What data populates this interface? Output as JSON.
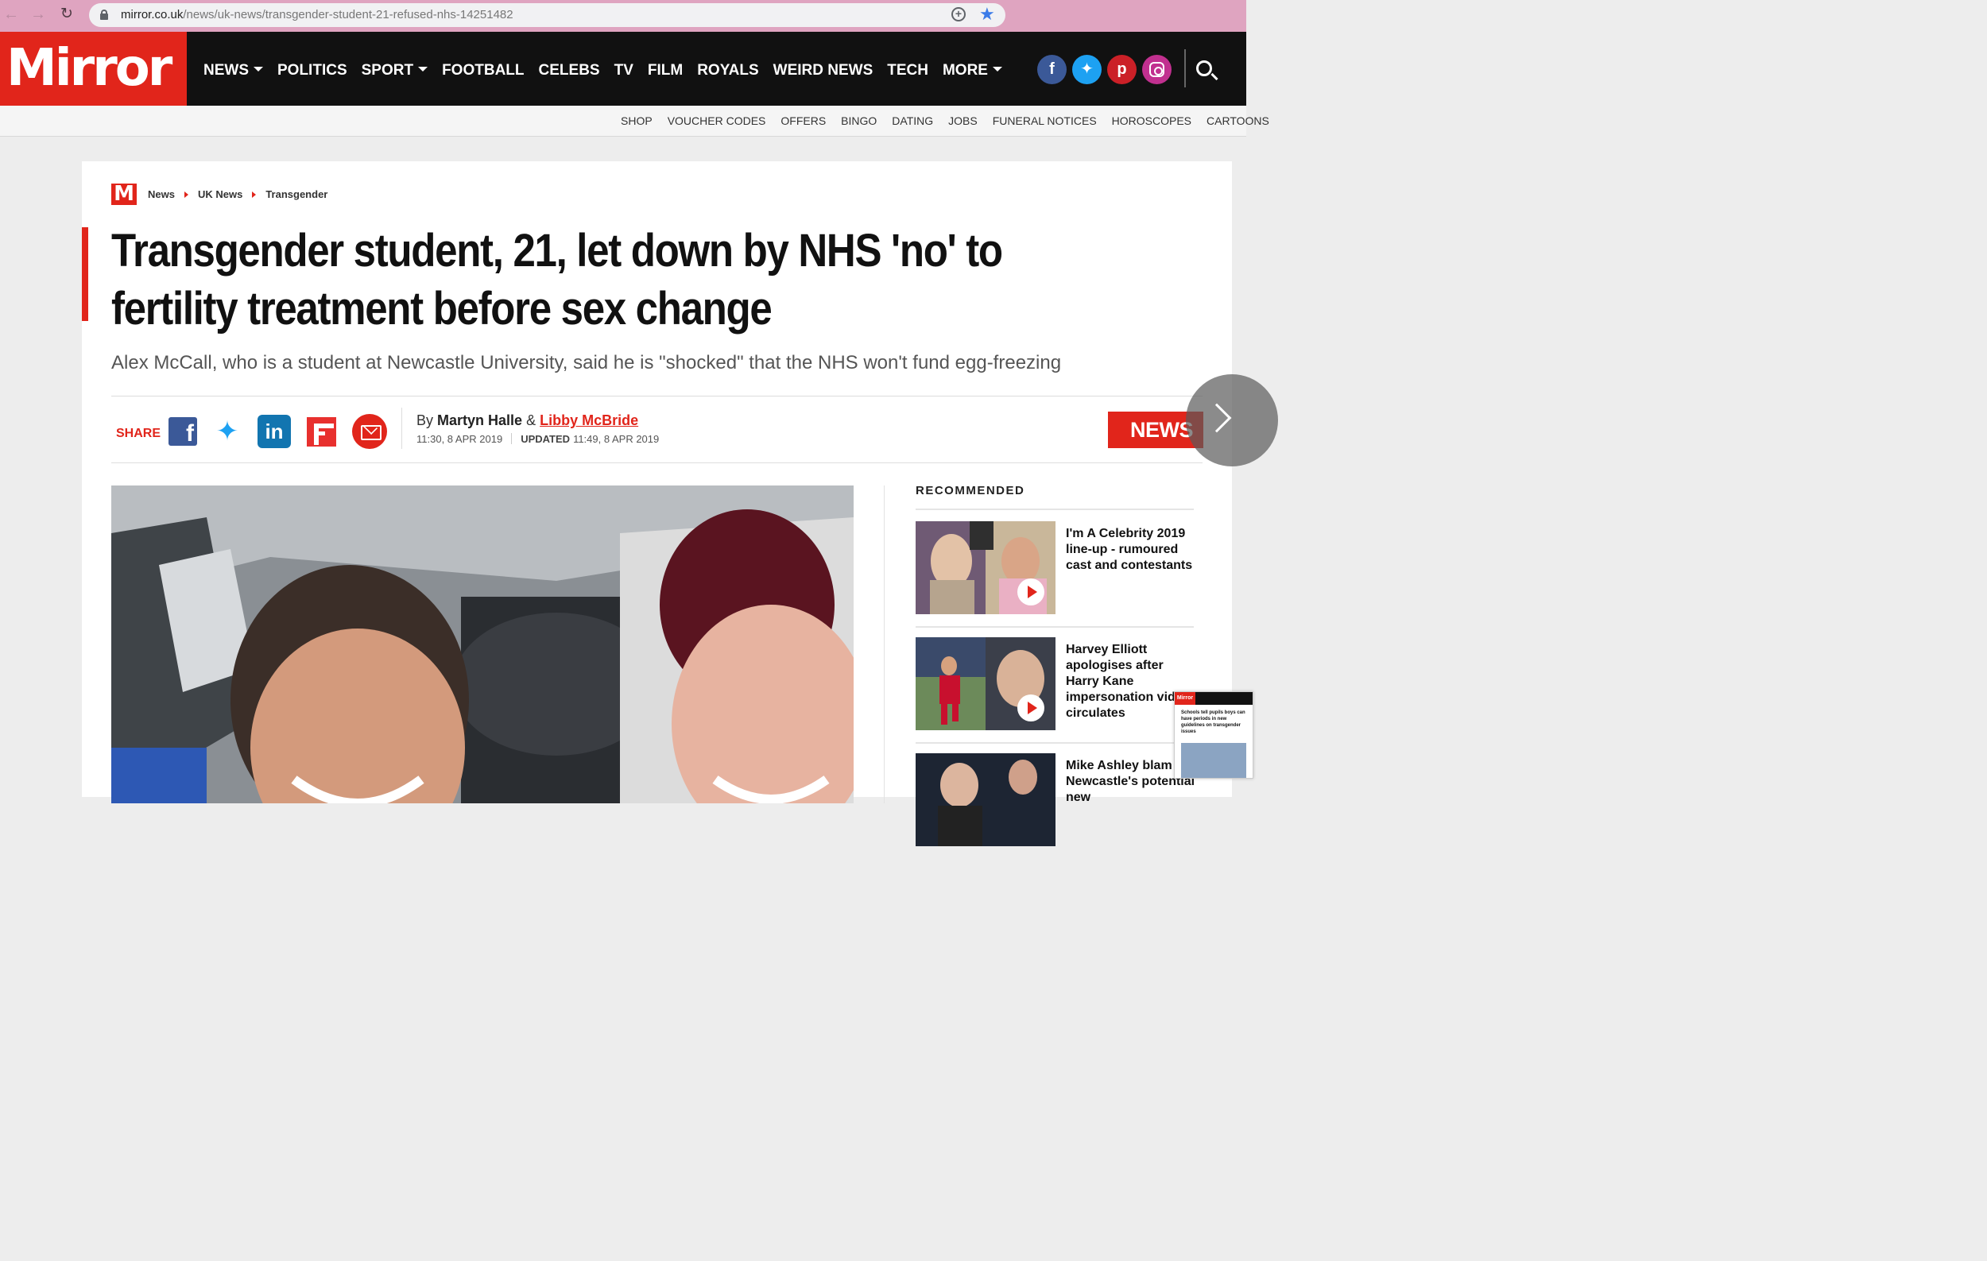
{
  "browser": {
    "url_domain": "mirror.co.uk",
    "url_path": "/news/uk-news/transgender-student-21-refused-nhs-14251482"
  },
  "header": {
    "logo": "Mirror",
    "nav": [
      "NEWS",
      "POLITICS",
      "SPORT",
      "FOOTBALL",
      "CELEBS",
      "TV",
      "FILM",
      "ROYALS",
      "WEIRD NEWS",
      "TECH",
      "MORE"
    ],
    "nav_dropdown": [
      "NEWS",
      "SPORT",
      "MORE"
    ],
    "social": [
      "facebook-icon",
      "twitter-icon",
      "pinterest-icon",
      "instagram-icon"
    ],
    "brand_color": "#e1251b"
  },
  "subnav": [
    "SHOP",
    "VOUCHER CODES",
    "OFFERS",
    "BINGO",
    "DATING",
    "JOBS",
    "FUNERAL NOTICES",
    "HOROSCOPES",
    "CARTOONS"
  ],
  "breadcrumb": {
    "logo": "M",
    "items": [
      "News",
      "UK News",
      "Transgender"
    ]
  },
  "article": {
    "headline": "Transgender student, 21, let down by NHS 'no' to fertility treatment before sex change",
    "standfirst": "Alex McCall, who is a student at Newcastle University, said he is \"shocked\" that the NHS won't fund egg-freezing",
    "share_label": "SHARE",
    "by": "By",
    "author1": "Martyn Halle",
    "amp": "&",
    "author2": "Libby McBride",
    "published": "11:30, 8 APR 2019",
    "updated_label": "UPDATED",
    "updated": "11:49, 8 APR 2019",
    "section_tag": "NEWS"
  },
  "recommended": {
    "title": "RECOMMENDED",
    "items": [
      {
        "headline": "I'm A Celebrity 2019 line-up - rumoured cast and contestants"
      },
      {
        "headline": "Harvey Elliott apologises after Harry Kane impersonation video circulates"
      },
      {
        "headline": "Mike Ashley blam Newcastle's potential new"
      }
    ]
  },
  "mini_preview": {
    "logo": "Mirror",
    "text": "Schools tell pupils boys can have periods in new guidelines on transgender issues"
  }
}
